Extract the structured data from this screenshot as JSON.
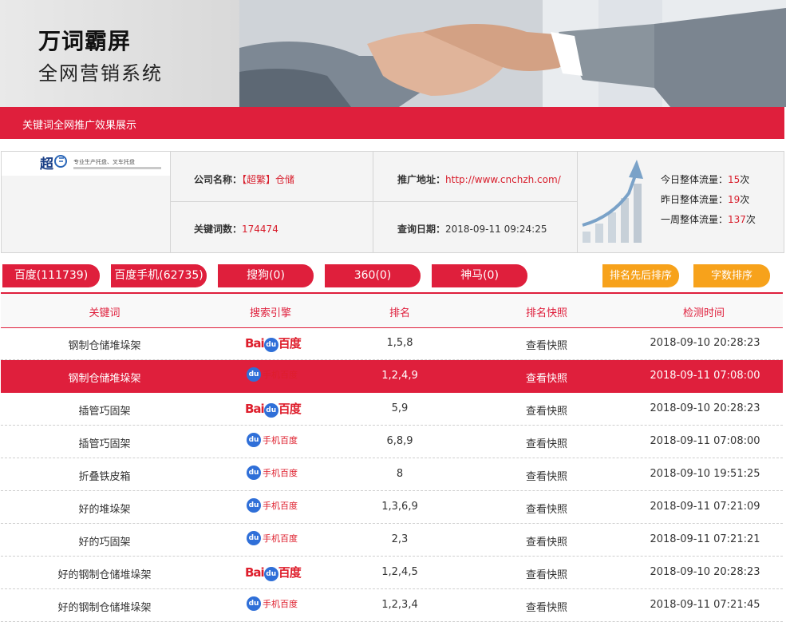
{
  "banner": {
    "title": "万词霸屏",
    "subtitle": "全网营销系统"
  },
  "section_title": "关键词全网推广效果展示",
  "company": {
    "name_label": "公司名称：",
    "name_value": "【超繁】仓储",
    "url_label": "推广地址：",
    "url_value": "http://www.cnchzh.com/",
    "keywords_label": "关键词数：",
    "keywords_value": "174474",
    "date_label": "查询日期：",
    "date_value": "2018-09-11 09:24:25"
  },
  "stats": {
    "today_label": "今日整体流量：",
    "today_value": "15",
    "today_unit": "次",
    "yesterday_label": "昨日整体流量：",
    "yesterday_value": "19",
    "yesterday_unit": "次",
    "week_label": "一周整体流量：",
    "week_value": "137",
    "week_unit": "次"
  },
  "tabs": [
    "百度(111739)",
    "百度手机(62735)",
    "搜狗(0)",
    "360(0)",
    "神马(0)"
  ],
  "sort_buttons": [
    "排名先后排序",
    "字数排序"
  ],
  "table": {
    "headers": [
      "关键词",
      "搜索引擎",
      "排名",
      "排名快照",
      "检测时间"
    ],
    "rows": [
      {
        "keyword": "钢制仓储堆垛架",
        "engine": "baidu",
        "rank": "1,5,8",
        "snapshot": "查看快照",
        "time": "2018-09-10 20:28:23"
      },
      {
        "keyword": "钢制仓储堆垛架",
        "engine": "mobile",
        "rank": "1,2,4,9",
        "snapshot": "查看快照",
        "time": "2018-09-11 07:08:00"
      },
      {
        "keyword": "插管巧固架",
        "engine": "baidu",
        "rank": "5,9",
        "snapshot": "查看快照",
        "time": "2018-09-10 20:28:23"
      },
      {
        "keyword": "插管巧固架",
        "engine": "mobile",
        "rank": "6,8,9",
        "snapshot": "查看快照",
        "time": "2018-09-11 07:08:00"
      },
      {
        "keyword": "折叠铁皮箱",
        "engine": "mobile",
        "rank": "8",
        "snapshot": "查看快照",
        "time": "2018-09-10 19:51:25"
      },
      {
        "keyword": "好的堆垛架",
        "engine": "mobile",
        "rank": "1,3,6,9",
        "snapshot": "查看快照",
        "time": "2018-09-11 07:21:09"
      },
      {
        "keyword": "好的巧固架",
        "engine": "mobile",
        "rank": "2,3",
        "snapshot": "查看快照",
        "time": "2018-09-11 07:21:21"
      },
      {
        "keyword": "好的钢制仓储堆垛架",
        "engine": "baidu",
        "rank": "1,2,4,5",
        "snapshot": "查看快照",
        "time": "2018-09-10 20:28:23"
      },
      {
        "keyword": "好的钢制仓储堆垛架",
        "engine": "mobile",
        "rank": "1,2,3,4",
        "snapshot": "查看快照",
        "time": "2018-09-11 07:21:45"
      }
    ]
  },
  "engine_labels": {
    "baidu_a": "Bai",
    "baidu_b": "百度",
    "paw": "du",
    "mobile": "手机百度"
  },
  "logo": {
    "mark": "超",
    "tagline": "专业生产托盘、叉车托盘"
  },
  "colors": {
    "accent": "#df1f3c",
    "orange": "#f7a21b",
    "red_text": "#d81e2c"
  }
}
